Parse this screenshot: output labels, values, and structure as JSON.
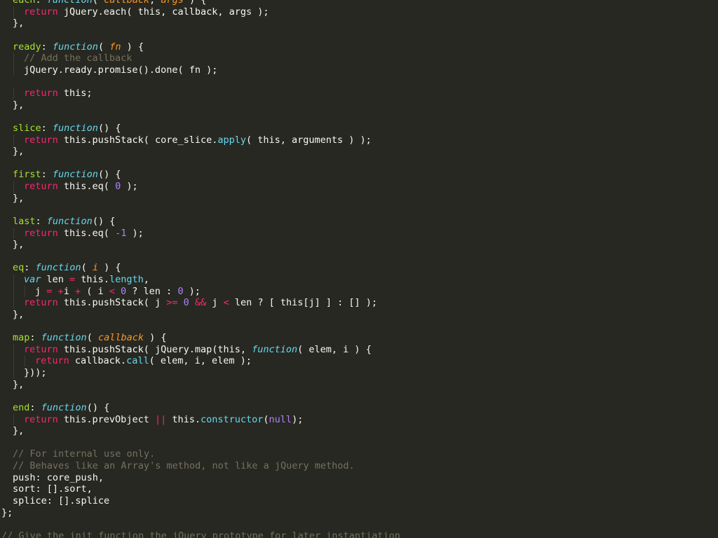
{
  "theme": {
    "background": "#272822",
    "plain": "#f8f8f2",
    "property": "#a6e22e",
    "keyword": "#f92672",
    "function": "#66d9ef",
    "parameter": "#fd971f",
    "number": "#ae81ff",
    "comment": "#75715e"
  },
  "code": {
    "lines": [
      {
        "indent": 1,
        "tokens": [
          {
            "t": "each",
            "k": "prop"
          },
          {
            "t": ": ",
            "k": "plain"
          },
          {
            "t": "function",
            "k": "fn"
          },
          {
            "t": "( ",
            "k": "plain"
          },
          {
            "t": "callback",
            "k": "param"
          },
          {
            "t": ", ",
            "k": "plain"
          },
          {
            "t": "args",
            "k": "param"
          },
          {
            "t": " ) {",
            "k": "plain"
          }
        ]
      },
      {
        "indent": 2,
        "tokens": [
          {
            "t": "return",
            "k": "kw"
          },
          {
            "t": " jQuery.each( this, callback, args );",
            "k": "plain"
          }
        ]
      },
      {
        "indent": 1,
        "tokens": [
          {
            "t": "},",
            "k": "plain"
          }
        ]
      },
      {
        "indent": 0,
        "tokens": []
      },
      {
        "indent": 1,
        "tokens": [
          {
            "t": "ready",
            "k": "prop"
          },
          {
            "t": ": ",
            "k": "plain"
          },
          {
            "t": "function",
            "k": "fn"
          },
          {
            "t": "( ",
            "k": "plain"
          },
          {
            "t": "fn",
            "k": "param"
          },
          {
            "t": " ) {",
            "k": "plain"
          }
        ]
      },
      {
        "indent": 2,
        "tokens": [
          {
            "t": "// Add the callback",
            "k": "comment"
          }
        ]
      },
      {
        "indent": 2,
        "tokens": [
          {
            "t": "jQuery.ready.promise().done( fn );",
            "k": "plain"
          }
        ]
      },
      {
        "indent": 0,
        "tokens": []
      },
      {
        "indent": 2,
        "tokens": [
          {
            "t": "return",
            "k": "kw"
          },
          {
            "t": " this;",
            "k": "plain"
          }
        ]
      },
      {
        "indent": 1,
        "tokens": [
          {
            "t": "},",
            "k": "plain"
          }
        ]
      },
      {
        "indent": 0,
        "tokens": []
      },
      {
        "indent": 1,
        "tokens": [
          {
            "t": "slice",
            "k": "prop"
          },
          {
            "t": ": ",
            "k": "plain"
          },
          {
            "t": "function",
            "k": "fn"
          },
          {
            "t": "() {",
            "k": "plain"
          }
        ]
      },
      {
        "indent": 2,
        "tokens": [
          {
            "t": "return",
            "k": "kw"
          },
          {
            "t": " this.pushStack( core_slice.",
            "k": "plain"
          },
          {
            "t": "apply",
            "k": "builtin"
          },
          {
            "t": "( this, arguments ) );",
            "k": "plain"
          }
        ]
      },
      {
        "indent": 1,
        "tokens": [
          {
            "t": "},",
            "k": "plain"
          }
        ]
      },
      {
        "indent": 0,
        "tokens": []
      },
      {
        "indent": 1,
        "tokens": [
          {
            "t": "first",
            "k": "prop"
          },
          {
            "t": ": ",
            "k": "plain"
          },
          {
            "t": "function",
            "k": "fn"
          },
          {
            "t": "() {",
            "k": "plain"
          }
        ]
      },
      {
        "indent": 2,
        "tokens": [
          {
            "t": "return",
            "k": "kw"
          },
          {
            "t": " this.eq( ",
            "k": "plain"
          },
          {
            "t": "0",
            "k": "num"
          },
          {
            "t": " );",
            "k": "plain"
          }
        ]
      },
      {
        "indent": 1,
        "tokens": [
          {
            "t": "},",
            "k": "plain"
          }
        ]
      },
      {
        "indent": 0,
        "tokens": []
      },
      {
        "indent": 1,
        "tokens": [
          {
            "t": "last",
            "k": "prop"
          },
          {
            "t": ": ",
            "k": "plain"
          },
          {
            "t": "function",
            "k": "fn"
          },
          {
            "t": "() {",
            "k": "plain"
          }
        ]
      },
      {
        "indent": 2,
        "tokens": [
          {
            "t": "return",
            "k": "kw"
          },
          {
            "t": " this.eq( ",
            "k": "plain"
          },
          {
            "t": "-1",
            "k": "num"
          },
          {
            "t": " );",
            "k": "plain"
          }
        ]
      },
      {
        "indent": 1,
        "tokens": [
          {
            "t": "},",
            "k": "plain"
          }
        ]
      },
      {
        "indent": 0,
        "tokens": []
      },
      {
        "indent": 1,
        "tokens": [
          {
            "t": "eq",
            "k": "prop"
          },
          {
            "t": ": ",
            "k": "plain"
          },
          {
            "t": "function",
            "k": "fn"
          },
          {
            "t": "( ",
            "k": "plain"
          },
          {
            "t": "i",
            "k": "param"
          },
          {
            "t": " ) {",
            "k": "plain"
          }
        ]
      },
      {
        "indent": 2,
        "tokens": [
          {
            "t": "var",
            "k": "fn"
          },
          {
            "t": " len ",
            "k": "plain"
          },
          {
            "t": "=",
            "k": "op"
          },
          {
            "t": " this.",
            "k": "plain"
          },
          {
            "t": "length",
            "k": "builtin"
          },
          {
            "t": ",",
            "k": "plain"
          }
        ]
      },
      {
        "indent": 3,
        "tokens": [
          {
            "t": "j ",
            "k": "plain"
          },
          {
            "t": "=",
            "k": "op"
          },
          {
            "t": " ",
            "k": "plain"
          },
          {
            "t": "+",
            "k": "op"
          },
          {
            "t": "i ",
            "k": "plain"
          },
          {
            "t": "+",
            "k": "op"
          },
          {
            "t": " ( i ",
            "k": "plain"
          },
          {
            "t": "<",
            "k": "op"
          },
          {
            "t": " ",
            "k": "plain"
          },
          {
            "t": "0",
            "k": "num"
          },
          {
            "t": " ? len : ",
            "k": "plain"
          },
          {
            "t": "0",
            "k": "num"
          },
          {
            "t": " );",
            "k": "plain"
          }
        ]
      },
      {
        "indent": 2,
        "tokens": [
          {
            "t": "return",
            "k": "kw"
          },
          {
            "t": " this.pushStack( j ",
            "k": "plain"
          },
          {
            "t": ">=",
            "k": "op"
          },
          {
            "t": " ",
            "k": "plain"
          },
          {
            "t": "0",
            "k": "num"
          },
          {
            "t": " ",
            "k": "plain"
          },
          {
            "t": "&&",
            "k": "op"
          },
          {
            "t": " j ",
            "k": "plain"
          },
          {
            "t": "<",
            "k": "op"
          },
          {
            "t": " len ? [ this[j] ] : [] );",
            "k": "plain"
          }
        ]
      },
      {
        "indent": 1,
        "tokens": [
          {
            "t": "},",
            "k": "plain"
          }
        ]
      },
      {
        "indent": 0,
        "tokens": []
      },
      {
        "indent": 1,
        "tokens": [
          {
            "t": "map",
            "k": "prop"
          },
          {
            "t": ": ",
            "k": "plain"
          },
          {
            "t": "function",
            "k": "fn"
          },
          {
            "t": "( ",
            "k": "plain"
          },
          {
            "t": "callback",
            "k": "param"
          },
          {
            "t": " ) {",
            "k": "plain"
          }
        ]
      },
      {
        "indent": 2,
        "tokens": [
          {
            "t": "return",
            "k": "kw"
          },
          {
            "t": " this.pushStack( jQuery.map(this, ",
            "k": "plain"
          },
          {
            "t": "function",
            "k": "fn"
          },
          {
            "t": "( elem, i ) {",
            "k": "plain"
          }
        ]
      },
      {
        "indent": 3,
        "tokens": [
          {
            "t": "return",
            "k": "kw"
          },
          {
            "t": " callback.",
            "k": "plain"
          },
          {
            "t": "call",
            "k": "builtin"
          },
          {
            "t": "( elem, i, elem );",
            "k": "plain"
          }
        ]
      },
      {
        "indent": 2,
        "tokens": [
          {
            "t": "}));",
            "k": "plain"
          }
        ]
      },
      {
        "indent": 1,
        "tokens": [
          {
            "t": "},",
            "k": "plain"
          }
        ]
      },
      {
        "indent": 0,
        "tokens": []
      },
      {
        "indent": 1,
        "tokens": [
          {
            "t": "end",
            "k": "prop"
          },
          {
            "t": ": ",
            "k": "plain"
          },
          {
            "t": "function",
            "k": "fn"
          },
          {
            "t": "() {",
            "k": "plain"
          }
        ]
      },
      {
        "indent": 2,
        "tokens": [
          {
            "t": "return",
            "k": "kw"
          },
          {
            "t": " this.prevObject ",
            "k": "plain"
          },
          {
            "t": "||",
            "k": "op"
          },
          {
            "t": " this.",
            "k": "plain"
          },
          {
            "t": "constructor",
            "k": "builtin"
          },
          {
            "t": "(",
            "k": "plain"
          },
          {
            "t": "null",
            "k": "const"
          },
          {
            "t": ");",
            "k": "plain"
          }
        ]
      },
      {
        "indent": 1,
        "tokens": [
          {
            "t": "},",
            "k": "plain"
          }
        ]
      },
      {
        "indent": 0,
        "tokens": []
      },
      {
        "indent": 1,
        "tokens": [
          {
            "t": "// For internal use only.",
            "k": "comment"
          }
        ]
      },
      {
        "indent": 1,
        "tokens": [
          {
            "t": "// Behaves like an Array's method, not like a jQuery method.",
            "k": "comment"
          }
        ]
      },
      {
        "indent": 1,
        "tokens": [
          {
            "t": "push: core_push,",
            "k": "plain"
          }
        ]
      },
      {
        "indent": 1,
        "tokens": [
          {
            "t": "sort: [].sort,",
            "k": "plain"
          }
        ]
      },
      {
        "indent": 1,
        "tokens": [
          {
            "t": "splice: [].splice",
            "k": "plain"
          }
        ]
      },
      {
        "indent": 0,
        "tokens": [
          {
            "t": "};",
            "k": "plain"
          }
        ]
      },
      {
        "indent": 0,
        "tokens": []
      },
      {
        "indent": 0,
        "tokens": [
          {
            "t": "// Give the init function the jQuery prototype for later instantiation",
            "k": "comment"
          }
        ]
      }
    ]
  }
}
